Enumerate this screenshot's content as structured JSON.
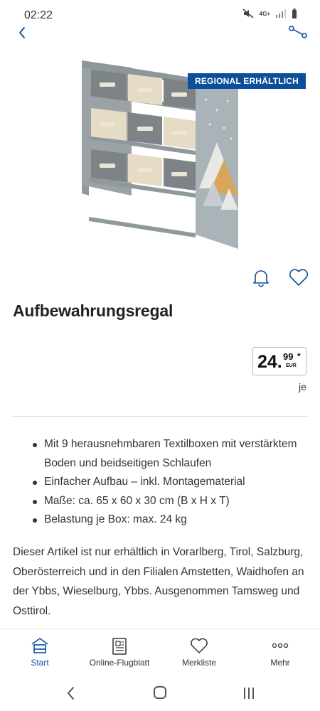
{
  "status_bar": {
    "time": "02:22",
    "network": "4G+"
  },
  "product": {
    "badge": "REGIONAL ERHÄLTLICH",
    "title": "Aufbewahrungsregal",
    "price": {
      "main": "24.",
      "cents": "99",
      "asterisk": "*",
      "currency": "EUR",
      "unit": "je"
    },
    "features": [
      "Mit 9 herausnehmbaren Textilboxen mit verstärktem Boden und beidseitigen Schlaufen",
      "Einfacher Aufbau – inkl. Montagematerial",
      "Maße: ca. 65 x 60 x 30 cm (B x H x T)",
      "Belastung je Box: max. 24 kg"
    ],
    "description": "Dieser Artikel ist nur erhältlich in Vorarlberg, Tirol, Salzburg, Oberösterreich und in den Filialen Amstetten, Waidhofen an der Ybbs, Wieselburg, Ybbs. Ausgenommen Tamsweg und Osttirol."
  },
  "bottom_nav": [
    {
      "label": "Start",
      "icon": "home-icon",
      "active": true
    },
    {
      "label": "Online-Flugblatt",
      "icon": "flyer-icon",
      "active": false
    },
    {
      "label": "Merkliste",
      "icon": "heart-icon",
      "active": false
    },
    {
      "label": "Mehr",
      "icon": "more-icon",
      "active": false
    }
  ],
  "colors": {
    "brand": "#0b4e9a",
    "text": "#333333"
  }
}
